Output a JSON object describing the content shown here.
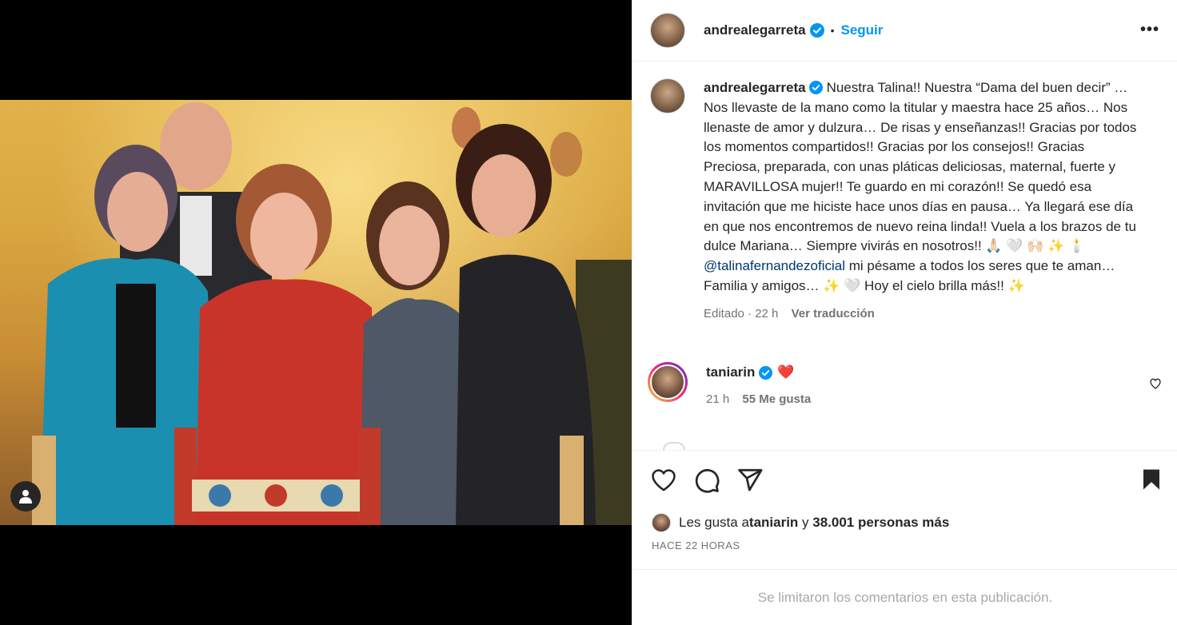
{
  "post": {
    "username": "andrealegarreta",
    "follow_label": "Seguir",
    "separator": "•",
    "more_label": "•••",
    "caption_text": "Nuestra Talina!! Nuestra “Dama del buen decir” … Nos llevaste de la mano como la titular y maestra hace 25 años… Nos llenaste de amor y dulzura… De risas y enseñanzas!! Gracias por todos los momentos compartidos!! Gracias por los consejos!! Gracias Preciosa, preparada, con unas pláticas deliciosas, maternal, fuerte y MARAVILLOSA mujer!! Te guardo en mi corazón!! Se quedó esa invitación que me hiciste hace unos días en pausa… Ya llegará ese día en que nos encontremos de nuevo reina linda!! Vuela a los brazos de tu dulce Mariana… Siempre vivirás en nosotros!! 🙏🏻 🤍 🙌🏻 ✨ 🕯️",
    "caption_mention": "@talinafernandezoficial",
    "caption_tail": " mi pésame a todos los seres que te aman… Familia y amigos… ✨ 🤍  Hoy el cielo brilla más!! ✨",
    "caption_meta": "Editado · 22 h",
    "translate_label": "Ver traducción"
  },
  "comment": {
    "username": "taniarin",
    "text": "❤️",
    "time": "21 h",
    "likes": "55 Me gusta"
  },
  "likes": {
    "prefix": "Les gusta a ",
    "user": "taniarin",
    "middle": " y ",
    "count": "38.001 personas más"
  },
  "time_ago": "HACE 22 HORAS",
  "comments_limited": "Se limitaron los comentarios en esta publicación.",
  "colors": {
    "link_blue": "#0095f6",
    "mention_blue": "#00376b",
    "muted": "#737373",
    "heart_red": "#ed4956"
  },
  "icons": [
    "user-tag-icon",
    "verified-icon",
    "more-icon",
    "heart-icon",
    "comment-icon",
    "share-icon",
    "bookmark-icon"
  ]
}
